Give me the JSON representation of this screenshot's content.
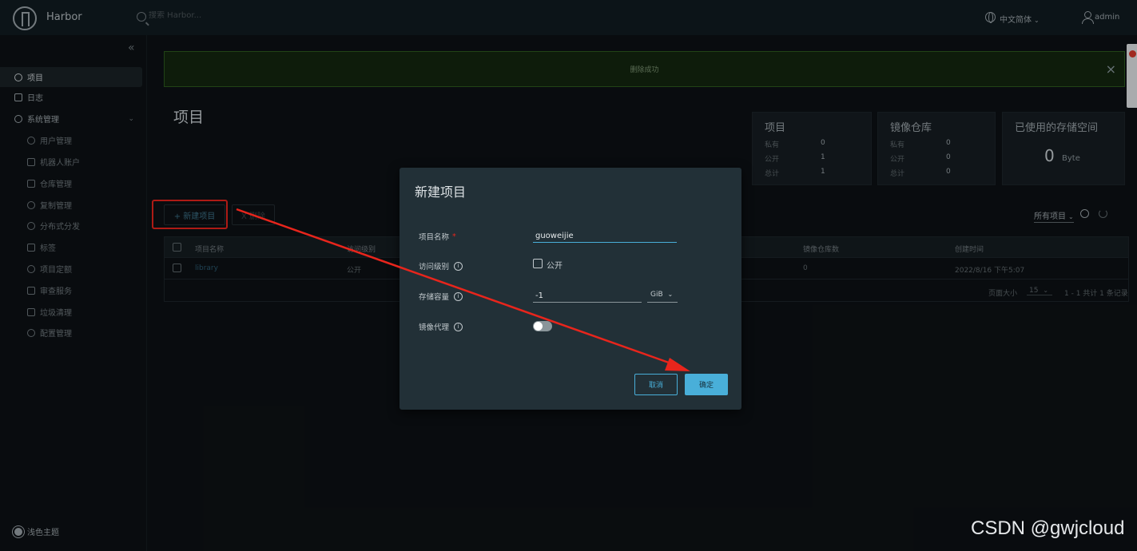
{
  "header": {
    "brand": "Harbor",
    "search_placeholder": "搜索 Harbor...",
    "language": "中文简体",
    "user": "admin"
  },
  "sidebar": {
    "items": [
      {
        "label": "项目",
        "icon": "projects-icon",
        "active": true
      },
      {
        "label": "日志",
        "icon": "logs-icon"
      },
      {
        "label": "系统管理",
        "icon": "admin-icon",
        "expandable": true
      },
      {
        "label": "用户管理",
        "icon": "users-icon",
        "sub": true
      },
      {
        "label": "机器人账户",
        "icon": "robot-icon",
        "sub": true
      },
      {
        "label": "仓库管理",
        "icon": "registry-icon",
        "sub": true
      },
      {
        "label": "复制管理",
        "icon": "cloud-icon",
        "sub": true
      },
      {
        "label": "分布式分发",
        "icon": "share-icon",
        "sub": true
      },
      {
        "label": "标签",
        "icon": "tag-icon",
        "sub": true
      },
      {
        "label": "项目定额",
        "icon": "quota-icon",
        "sub": true
      },
      {
        "label": "审查服务",
        "icon": "shield-icon",
        "sub": true
      },
      {
        "label": "垃圾清理",
        "icon": "trash-icon",
        "sub": true
      },
      {
        "label": "配置管理",
        "icon": "gear-icon",
        "sub": true
      }
    ],
    "theme_toggle": "浅色主题"
  },
  "banner": {
    "message": "删除成功",
    "close": "×",
    "color": "#13260f"
  },
  "page": {
    "title": "项目"
  },
  "stats": {
    "projects": {
      "title": "项目",
      "rows": [
        {
          "label": "私有",
          "value": "0"
        },
        {
          "label": "公开",
          "value": "1"
        },
        {
          "label": "总计",
          "value": "1"
        }
      ]
    },
    "repositories": {
      "title": "镜像仓库",
      "rows": [
        {
          "label": "私有",
          "value": "0"
        },
        {
          "label": "公开",
          "value": "0"
        },
        {
          "label": "总计",
          "value": "0"
        }
      ]
    },
    "storage": {
      "title": "已使用的存储空间",
      "value": "0",
      "unit": "Byte"
    }
  },
  "toolbar": {
    "new_project": "+ 新建项目",
    "delete": "X 删除",
    "filter": "所有项目"
  },
  "table": {
    "headers": [
      "项目名称",
      "访问级别",
      "镜像仓库数",
      "创建时间"
    ],
    "rows": [
      {
        "name": "library",
        "access": "公开",
        "repos": "0",
        "created": "2022/8/16 下午5:07"
      }
    ],
    "page_size_label": "页面大小",
    "page_size": "15",
    "page_info": "1 - 1 共计 1 条记录"
  },
  "modal": {
    "title": "新建项目",
    "name_label": "项目名称",
    "name_required": "*",
    "name_value": "guoweijie",
    "access_label": "访问级别",
    "public_label": "公开",
    "quota_label": "存储容量",
    "quota_value": "-1",
    "quota_unit": "GiB",
    "proxy_label": "镜像代理",
    "cancel": "取消",
    "ok": "确定",
    "accent": "#49afd9"
  },
  "annotation": {
    "color": "#e8251c"
  },
  "watermark": "CSDN @gwjcloud"
}
